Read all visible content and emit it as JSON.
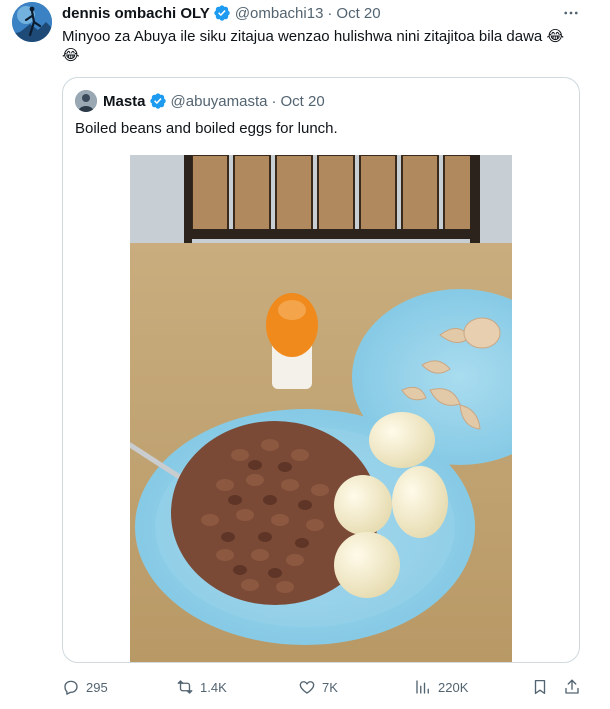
{
  "tweet": {
    "author_name": "dennis ombachi OLY",
    "handle": "@ombachi13",
    "separator": "·",
    "date": "Oct 20",
    "text": "Minyoo za Abuya ile siku zitajua wenzao hulishwa nini zitajitoa bila dawa",
    "emoji_1": "😂",
    "emoji_2": "😂",
    "more_icon": "ellipsis-icon",
    "verified_color": "#1d9bf0"
  },
  "quote": {
    "author_name": "Masta",
    "handle": "@abuyamasta",
    "separator": "·",
    "date": "Oct 20",
    "text": "Boiled beans and boiled eggs for lunch."
  },
  "actions": {
    "replies": "295",
    "retweets": "1.4K",
    "likes": "7K",
    "views": "220K",
    "reply_icon": "reply-icon",
    "retweet_icon": "retweet-icon",
    "like_icon": "heart-icon",
    "views_icon": "views-icon",
    "bookmark_icon": "bookmark-icon",
    "share_icon": "share-icon"
  }
}
